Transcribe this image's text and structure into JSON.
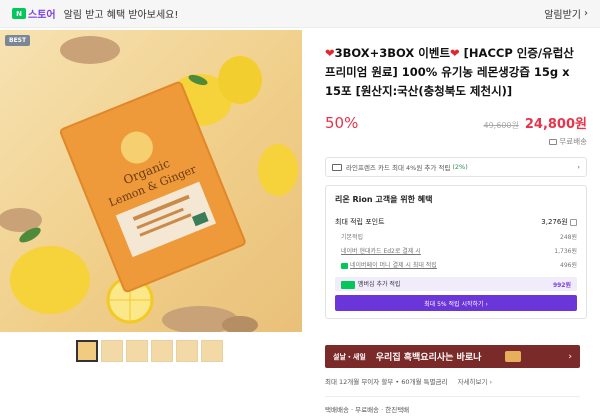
{
  "topbar": {
    "n_badge": "N",
    "store_label": "스토어",
    "message": "알림 받고 혜택 받아보세요!",
    "alarm_button": "알림받기",
    "alarm_chevron": "›"
  },
  "product": {
    "badge": "BEST",
    "thumbnail_count": 6,
    "title_prefix": "3BOX+3BOX 이벤트",
    "title_main": " [HACCP 인증/유럽산 프리미엄 원료] 100% 유기농 레몬생강즙 15g x 15포 [원산지:국산(충청북도 제천시)]",
    "discount": "50%",
    "original_price": "49,600원",
    "price": "24,800원",
    "shipping": "무료배송"
  },
  "card_promo": {
    "text": "라인프렌즈 카드 최대 4%원 추가 적립",
    "accent": "(2%)",
    "chevron": "›"
  },
  "benefits": {
    "title_prefix": "리온 ",
    "username": "Rion",
    "title_suffix": " 고객을 위한 혜택",
    "max_points_label": "최대 적립 포인트",
    "max_points_value": "3,276원",
    "basic_label": "기본적립",
    "basic_value": "248원",
    "hyundai_label": "네이버 현대카드 Ed2로 결제 시",
    "hyundai_value": "1,736원",
    "money_label": "네이버페이 머니 결제 시 최대 적립",
    "money_value": "496원",
    "membership_label": "멤버십 추가 적립",
    "membership_value": "992원",
    "join_button": "최대 5% 적립 시작하기 ›"
  },
  "ad": {
    "tag": "설날・새일",
    "text": "우리집 흑백요리사는 바로나",
    "arrow": "›"
  },
  "installment": {
    "text": "최대 12개월 무이자 할부 • 60개월 특별금리",
    "more": "자세히보기 ›"
  },
  "delivery": {
    "text": "택배배송 · 무료배송 · 한진택배"
  },
  "colors": {
    "accent_purple": "#7b3fe4",
    "price_red": "#e8334a",
    "naver_green": "#03c75a",
    "ad_bg": "#7b2a2a"
  }
}
